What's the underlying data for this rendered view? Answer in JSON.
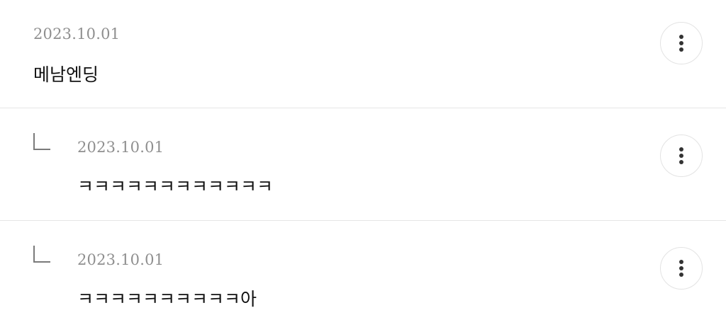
{
  "comments": [
    {
      "date": "2023.10.01",
      "text": "메남엔딩",
      "is_reply": false,
      "more_icon": "more-vertical-icon"
    },
    {
      "date": "2023.10.01",
      "text": "ㅋㅋㅋㅋㅋㅋㅋㅋㅋㅋㅋㅋ",
      "is_reply": true,
      "reply_icon": "reply-arrow-icon",
      "more_icon": "more-vertical-icon"
    },
    {
      "date": "2023.10.01",
      "text": "ㅋㅋㅋㅋㅋㅋㅋㅋㅋㅋ아",
      "is_reply": true,
      "reply_icon": "reply-arrow-icon",
      "more_icon": "more-vertical-icon"
    }
  ],
  "colors": {
    "date": "#8f8f8f",
    "text": "#111111",
    "divider": "#e6e6e6",
    "button_border": "#e3e3e3",
    "icon": "#333333"
  }
}
